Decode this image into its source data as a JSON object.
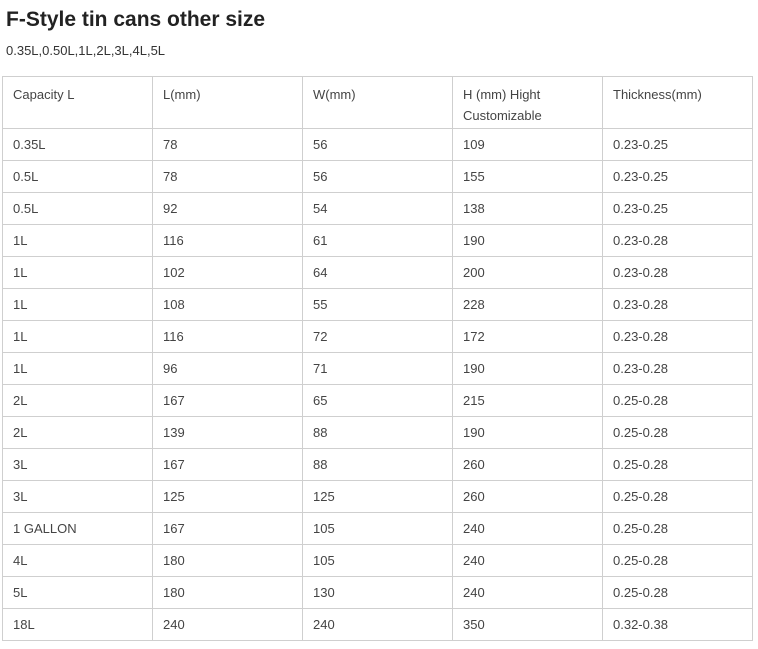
{
  "page": {
    "title": "F-Style tin cans other size",
    "subtitle": "0.35L,0.50L,1L,2L,3L,4L,5L"
  },
  "table": {
    "headers": [
      "Capacity L",
      "L(mm)",
      "W(mm)",
      "H (mm) Hight Customizable",
      "Thickness(mm)"
    ],
    "rows": [
      [
        "0.35L",
        "78",
        "56",
        "109",
        "0.23-0.25"
      ],
      [
        "0.5L",
        "78",
        "56",
        "155",
        "0.23-0.25"
      ],
      [
        "0.5L",
        "92",
        "54",
        "138",
        "0.23-0.25"
      ],
      [
        "1L",
        "116",
        "61",
        "190",
        "0.23-0.28"
      ],
      [
        "1L",
        "102",
        "64",
        "200",
        "0.23-0.28"
      ],
      [
        "1L",
        "108",
        "55",
        "228",
        "0.23-0.28"
      ],
      [
        "1L",
        "116",
        "72",
        "172",
        "0.23-0.28"
      ],
      [
        "1L",
        "96",
        "71",
        "190",
        "0.23-0.28"
      ],
      [
        "2L",
        "167",
        "65",
        "215",
        "0.25-0.28"
      ],
      [
        "2L",
        "139",
        "88",
        "190",
        "0.25-0.28"
      ],
      [
        "3L",
        "167",
        "88",
        "260",
        "0.25-0.28"
      ],
      [
        "3L",
        "125",
        "125",
        "260",
        "0.25-0.28"
      ],
      [
        "1 GALLON",
        "167",
        "105",
        "240",
        "0.25-0.28"
      ],
      [
        "4L",
        "180",
        "105",
        "240",
        "0.25-0.28"
      ],
      [
        "5L",
        "180",
        "130",
        "240",
        "0.25-0.28"
      ],
      [
        "18L",
        "240",
        "240",
        "350",
        "0.32-0.38"
      ]
    ]
  }
}
